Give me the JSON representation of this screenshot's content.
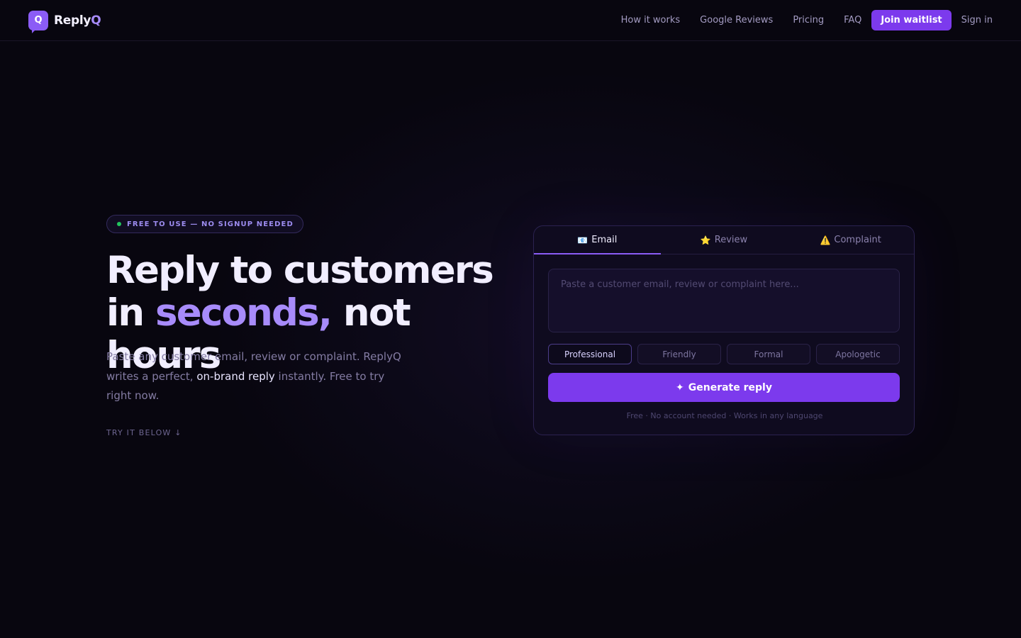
{
  "brand": {
    "logo_letter": "Q",
    "name_part1": "Reply",
    "name_part2": "Q"
  },
  "nav": {
    "links": [
      "How it works",
      "Google Reviews",
      "Pricing",
      "FAQ"
    ],
    "cta": "Join waitlist",
    "signin": "Sign in"
  },
  "hero": {
    "badge": "FREE TO USE — NO SIGNUP NEEDED",
    "headline_line1": "Reply to customers",
    "headline_line2_prefix": "in ",
    "headline_highlight": "seconds,",
    "headline_line2_suffix": " not hours",
    "sub_part1": "Paste any customer email, review or complaint. ReplyQ writes a perfect, ",
    "sub_strong": "on-brand reply",
    "sub_part2": " instantly. Free to try right now.",
    "try_label": "TRY IT BELOW ↓"
  },
  "composer": {
    "tabs": [
      {
        "icon": "📧",
        "icon_name": "email-icon",
        "label": "Email"
      },
      {
        "icon": "⭐",
        "icon_name": "star-icon",
        "label": "Review"
      },
      {
        "icon": "⚠️",
        "icon_name": "warning-icon",
        "label": "Complaint"
      }
    ],
    "active_tab": "Email",
    "input_placeholder": "Paste a customer email, review or complaint here...",
    "input_value": "",
    "tones": [
      "Professional",
      "Friendly",
      "Formal",
      "Apologetic"
    ],
    "selected_tone": "Professional",
    "generate_icon": "✦",
    "generate_label": "Generate reply",
    "footnote": "Free · No account needed · Works in any language"
  },
  "colors": {
    "accent": "#7c3aed",
    "accent_light": "#a78bfa",
    "background": "#08060f",
    "status_dot": "#22c55e"
  }
}
